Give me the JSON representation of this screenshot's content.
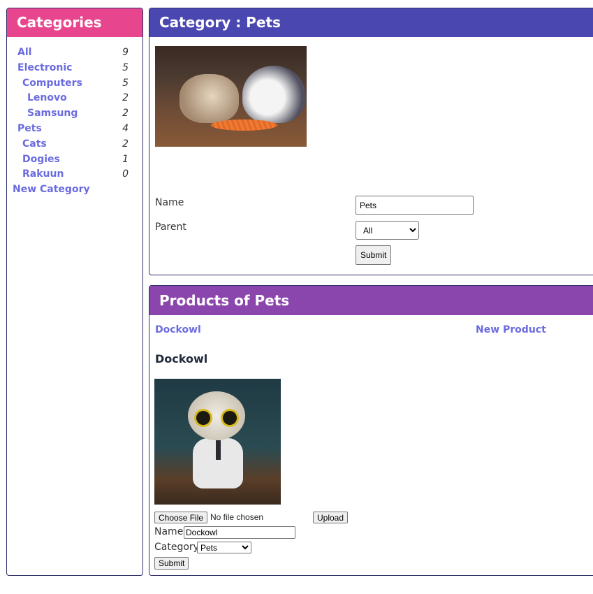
{
  "sidebar": {
    "title": "Categories",
    "items": [
      {
        "label": "All",
        "count": "9",
        "level": 0
      },
      {
        "label": "Electronic",
        "count": "5",
        "level": 0
      },
      {
        "label": "Computers",
        "count": "5",
        "level": 1
      },
      {
        "label": "Lenovo",
        "count": "2",
        "level": 2
      },
      {
        "label": "Samsung",
        "count": "2",
        "level": 2
      },
      {
        "label": "Pets",
        "count": "4",
        "level": 0
      },
      {
        "label": "Cats",
        "count": "2",
        "level": 1
      },
      {
        "label": "Dogies",
        "count": "1",
        "level": 1
      },
      {
        "label": "Rakuun",
        "count": "0",
        "level": 1
      }
    ],
    "new_category": "New Category"
  },
  "category": {
    "title": "Category : Pets",
    "image_alt": "guinea-pigs-image",
    "name_label": "Name",
    "name_value": "Pets",
    "parent_label": "Parent",
    "parent_value": "All",
    "submit_label": "Submit"
  },
  "products": {
    "title": "Products of Pets",
    "list": [
      {
        "label": "Dockowl"
      }
    ],
    "new_product": "New Product",
    "selected": {
      "title": "Dockowl",
      "image_alt": "owl-doctor-image",
      "choose_file_label": "Choose File",
      "file_status": "No file chosen",
      "upload_label": "Upload",
      "name_label": "Name",
      "name_value": "Dockowl",
      "category_label": "Category",
      "category_value": "Pets",
      "submit_label": "Submit"
    }
  },
  "colors": {
    "categories_header": "#e8458f",
    "category_header": "#4a47b0",
    "products_header": "#8b46ad",
    "link": "#6b6be0"
  }
}
